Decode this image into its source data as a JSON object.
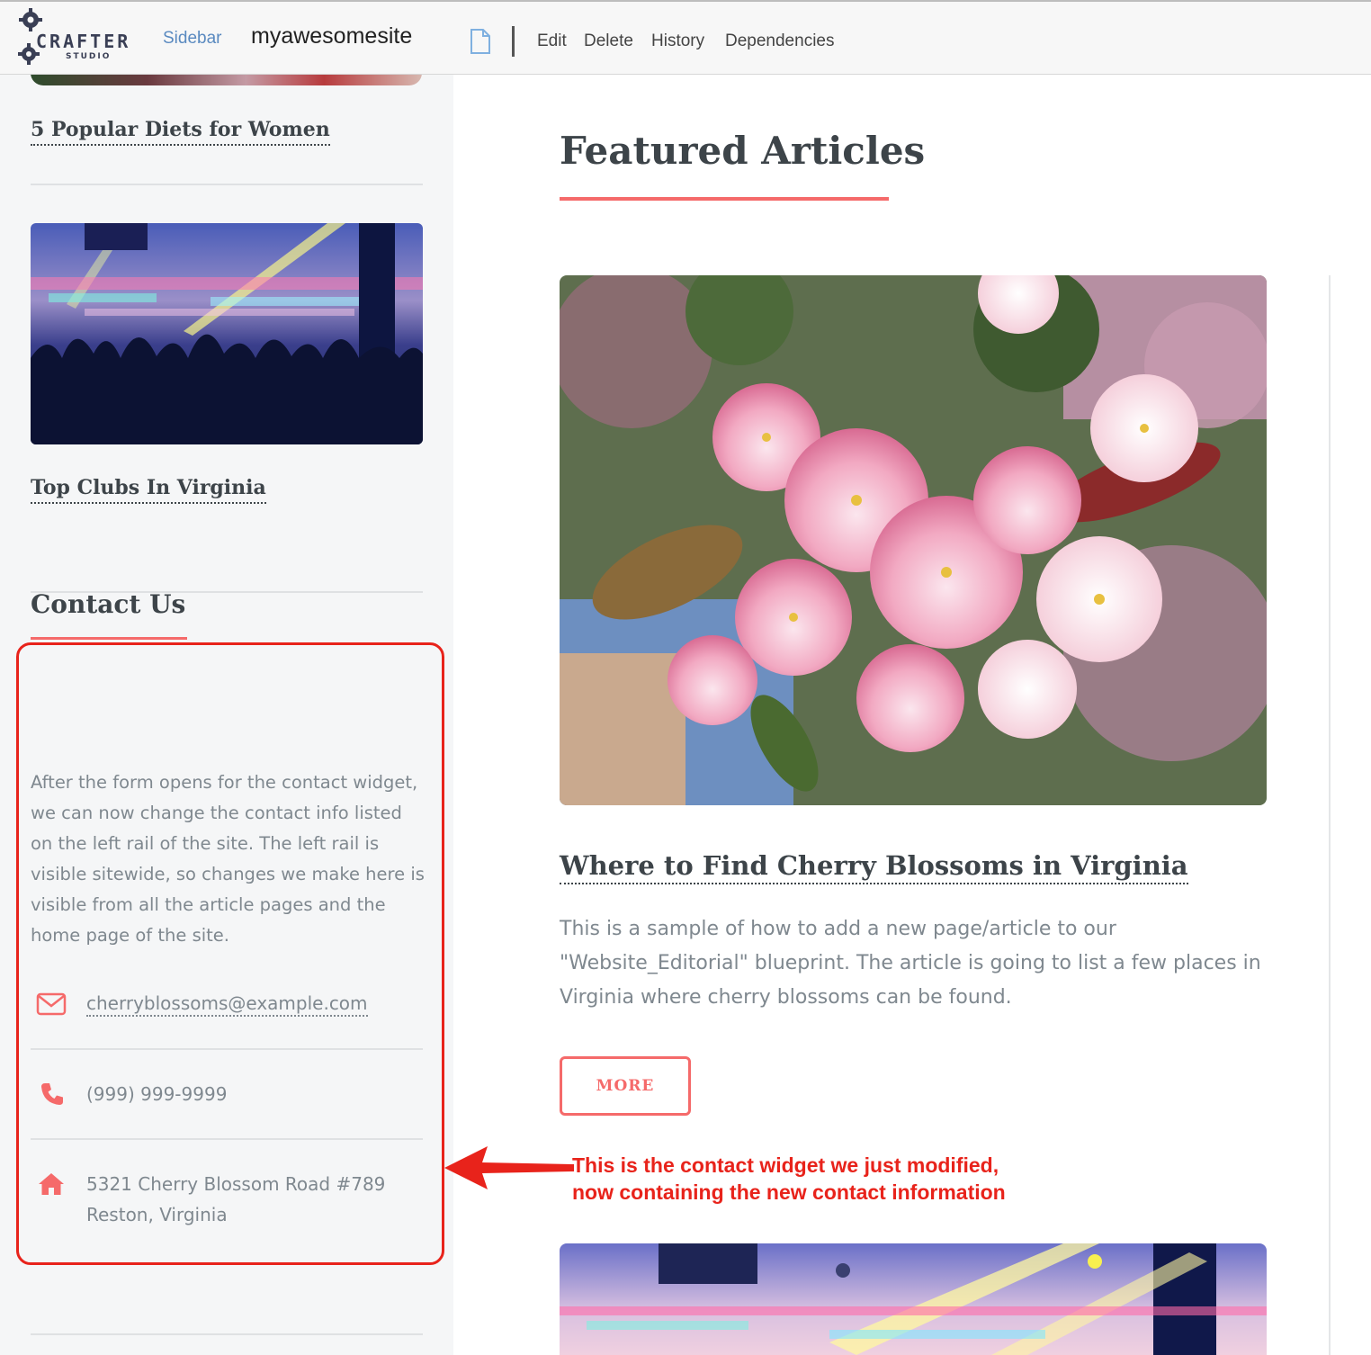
{
  "toolbar": {
    "logo_text": "CRAFTER",
    "logo_sub": "STUDIO",
    "sidebar_link": "Sidebar",
    "site_name": "myawesomesite",
    "actions": [
      "Edit",
      "Delete",
      "History",
      "Dependencies"
    ],
    "icons": [
      "gear-logo-icon",
      "document-icon"
    ]
  },
  "sidebar": {
    "articles": [
      {
        "title": "5 Popular Diets for Women"
      },
      {
        "title": "Top Clubs In Virginia"
      }
    ],
    "contact": {
      "heading": "Contact Us",
      "description": "After the form opens for the contact widget, we can now change the contact info listed on the left rail of the site.  The left rail is visible sitewide, so changes we make here is visible from all the article pages and the home page of the site.",
      "email": "cherryblossoms@example.com",
      "phone": "(999) 999-9999",
      "address_line1": "5321 Cherry Blossom Road #789",
      "address_line2": "Reston, Virginia",
      "icons": [
        "envelope-icon",
        "phone-icon",
        "home-icon"
      ]
    }
  },
  "main": {
    "heading": "Featured Articles",
    "article": {
      "title": "Where to Find Cherry Blossoms in Virginia",
      "summary": "This is a sample of how to add a new page/article to our \"Website_Editorial\" blueprint. The article is going to list a few places in Virginia where cherry blossoms can be found.",
      "button": "MORE"
    }
  },
  "annotation": {
    "line1": "This is the contact widget we just modified,",
    "line2": "now containing the new contact information"
  },
  "colors": {
    "accent": "#f56a6a",
    "annotation_red": "#e8231b",
    "link_blue": "#5a8ac0",
    "text_dark": "#3d4449",
    "text_muted": "#7f888f"
  }
}
